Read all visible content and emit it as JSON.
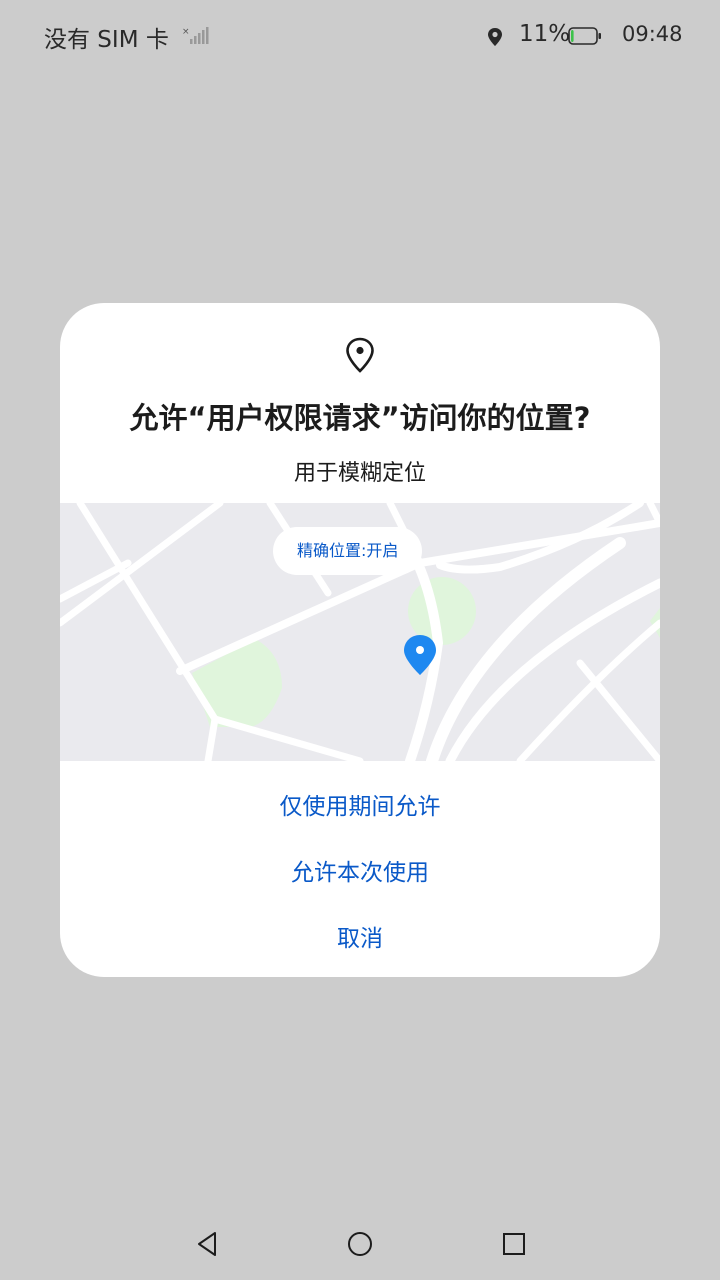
{
  "status_bar": {
    "carrier": "没有 SIM 卡",
    "battery_percent": "11%",
    "battery_level": 0.11,
    "time": "09:48",
    "icons": [
      "signal-icon",
      "location-icon",
      "battery-icon"
    ]
  },
  "dialog": {
    "icon": "location-pin-icon",
    "title": "允许“用户权限请求”访问你的位置?",
    "subtitle": "用于模糊定位",
    "map": {
      "precise_label": "精确位置:开启",
      "marker_icon": "map-marker-icon"
    },
    "buttons": {
      "while_using": "仅使用期间允许",
      "only_this_time": "允许本次使用",
      "cancel": "取消"
    }
  },
  "nav_bar": {
    "icons": [
      "back-icon",
      "home-icon",
      "recent-apps-icon"
    ]
  },
  "colors": {
    "accent": "#0a59c8",
    "map_marker": "#1e88f0",
    "map_green": "#e0f5dc",
    "background": "#cccccc"
  }
}
